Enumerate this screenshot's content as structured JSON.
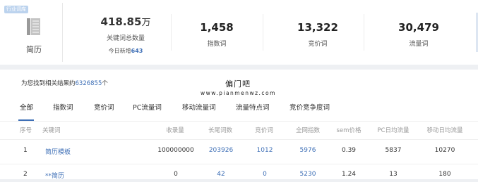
{
  "stats": {
    "industry_tag": "行业词库",
    "category_name": "简历",
    "total_value": "418.85",
    "total_unit": "万",
    "total_label": "关键词总数量",
    "today_prefix": "今日新增",
    "today_count": "643",
    "columns": [
      {
        "value": "1,458",
        "label": "指数词"
      },
      {
        "value": "13,322",
        "label": "竞价词"
      },
      {
        "value": "30,479",
        "label": "流量词"
      }
    ]
  },
  "results": {
    "summary_prefix": "为您找到相关结果约",
    "summary_count": "6326855",
    "summary_suffix": "个",
    "watermark_title": "偏门吧",
    "watermark_url": "www.pianmenwz.com"
  },
  "tabs": [
    "全部",
    "指数词",
    "竞价词",
    "PC流量词",
    "移动流量词",
    "流量特点词",
    "竞价竞争度词"
  ],
  "table": {
    "headers": [
      "序号",
      "关键词",
      "收录量",
      "长尾词数",
      "竞价词",
      "全网指数",
      "sem价格",
      "PC日均流量",
      "移动日均流量"
    ],
    "rows": [
      [
        "1",
        "简历模板",
        "100000000",
        "203926",
        "1012",
        "5976",
        "0.39",
        "5837",
        "10270"
      ],
      [
        "2",
        "**简历",
        "0",
        "42",
        "0",
        "5230",
        "1.24",
        "13",
        "180"
      ]
    ]
  },
  "colors": {
    "accent": "#3e6fb6",
    "tag_bg": "#bcd3ee",
    "page_bg": "#eef0f3"
  }
}
